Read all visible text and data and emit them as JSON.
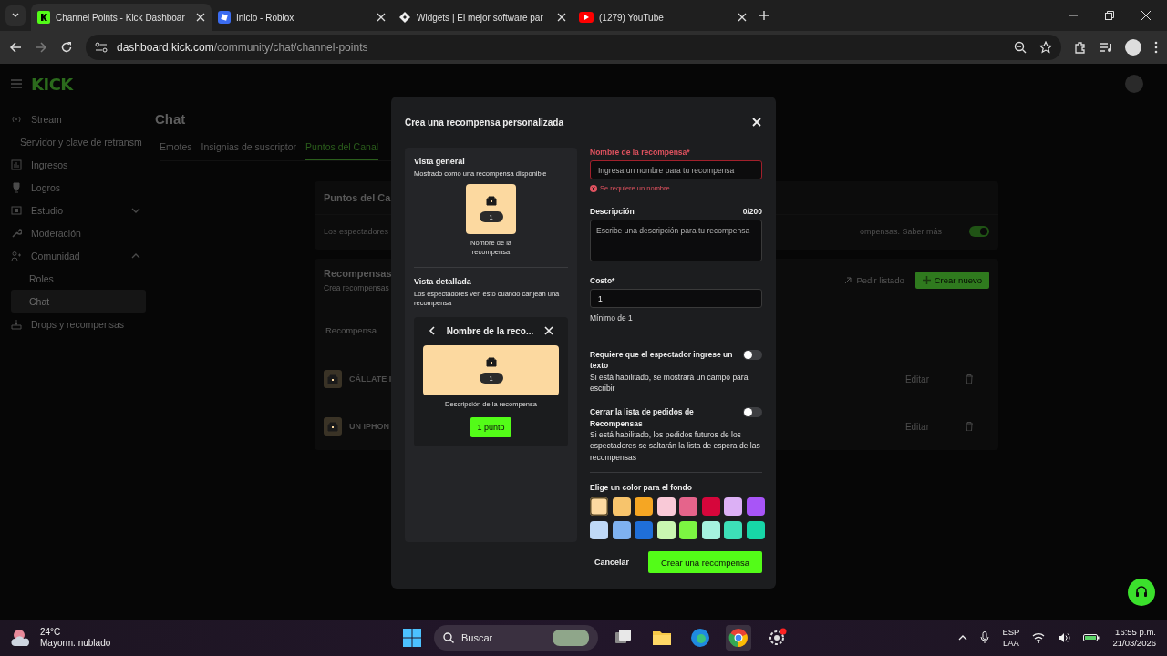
{
  "browser": {
    "tabs": [
      {
        "title": "Channel Points - Kick Dashboar",
        "selected": true
      },
      {
        "title": "Inicio - Roblox",
        "selected": false
      },
      {
        "title": "Widgets | El mejor software par",
        "selected": false
      },
      {
        "title": "(1279) YouTube",
        "selected": false
      }
    ],
    "url_host": "dashboard.kick.com",
    "url_path": "/community/chat/channel-points"
  },
  "sidebar": {
    "logo": "KICK",
    "items": [
      {
        "label": "Stream",
        "children": [
          {
            "label": "Servidor y clave de retransm",
            "selected": false
          }
        ]
      },
      {
        "label": "Ingresos"
      },
      {
        "label": "Logros"
      },
      {
        "label": "Estudio",
        "expanded": false
      },
      {
        "label": "Moderación"
      },
      {
        "label": "Comunidad",
        "expanded": true,
        "children": [
          {
            "label": "Roles",
            "selected": false
          },
          {
            "label": "Chat",
            "selected": true
          }
        ]
      },
      {
        "label": "Drops y recompensas"
      }
    ]
  },
  "content": {
    "title": "Chat",
    "tabs": [
      {
        "label": "Emotes",
        "selected": false
      },
      {
        "label": "Insignias de suscriptor",
        "selected": false
      },
      {
        "label": "Puntos del Canal",
        "selected": true
      }
    ],
    "points_card": {
      "title": "Puntos del Ca",
      "text_left": "Los espectadores",
      "text_right": "ompensas. Saber más",
      "enabled": true
    },
    "rewards_card": {
      "title": "Recompensas",
      "subtitle": "Crea recompensas",
      "request_button": "Pedir listado",
      "create_button": "Crear nuevo",
      "column_1": "Recompensa",
      "rows": [
        {
          "name": "CÁLLATE I",
          "edit": "Editar"
        },
        {
          "name": "UN IPHON",
          "edit": "Editar"
        }
      ]
    }
  },
  "modal": {
    "title": "Crea una recompensa personalizada",
    "preview": {
      "overview_title": "Vista general",
      "overview_subtitle": "Mostrado como una recompensa disponible",
      "tile_cost": "1",
      "tile_name": "Nombre de la recompensa",
      "detail_title": "Vista detallada",
      "detail_subtitle": "Los espectadores ven esto cuando canjean una recompensa",
      "detail_header": "Nombre de la reco...",
      "detail_cost": "1",
      "detail_description": "Descripción de la recompensa",
      "redeem_button": "1 punto"
    },
    "name_field": {
      "label": "Nombre de la recompensa*",
      "placeholder": "Ingresa un nombre para tu recompensa",
      "invalid": true,
      "error": "Se requiere un nombre"
    },
    "description_field": {
      "label": "Descripción",
      "counter": "0/200",
      "placeholder": "Escribe una descripción para tu recompensa"
    },
    "cost_field": {
      "label": "Costo*",
      "value": "1",
      "hint": "Mínimo de 1"
    },
    "toggles": [
      {
        "title": "Requiere que el espectador ingrese un texto",
        "description": "Si está habilitado, se mostrará un campo para escribir",
        "on": false
      },
      {
        "title": "Cerrar la lista de pedidos de Recompensas",
        "description": "Si está habilitado, los pedidos futuros de los espectadores se saltarán la lista de espera de las recompensas",
        "on": false
      }
    ],
    "color_label": "Elige un color para el fondo",
    "swatches": [
      {
        "color": "#fcd9a0",
        "selected": true
      },
      {
        "color": "#f7c46c",
        "selected": false
      },
      {
        "color": "#f5a623",
        "selected": false
      },
      {
        "color": "#f9c9d7",
        "selected": false
      },
      {
        "color": "#e5648b",
        "selected": false
      },
      {
        "color": "#d6063b",
        "selected": false
      },
      {
        "color": "#dcb0f5",
        "selected": false
      },
      {
        "color": "#a855f7",
        "selected": false
      },
      {
        "color": "#bfd9f7",
        "selected": false
      },
      {
        "color": "#7fb2f0",
        "selected": false
      },
      {
        "color": "#1f6fd8",
        "selected": false
      },
      {
        "color": "#c9f7b0",
        "selected": false
      },
      {
        "color": "#7cf542",
        "selected": false
      },
      {
        "color": "#a5f2df",
        "selected": false
      },
      {
        "color": "#3ddfb7",
        "selected": false
      },
      {
        "color": "#17d6a7",
        "selected": false
      }
    ],
    "cancel_button": "Cancelar",
    "create_button": "Crear una recompensa"
  },
  "taskbar": {
    "temperature": "24°C",
    "weather": "Mayorm. nublado",
    "search_placeholder": "Buscar",
    "language": "ESP",
    "layout": "LAA",
    "time": "16:55 p.m.",
    "date": "21/03/2026"
  }
}
